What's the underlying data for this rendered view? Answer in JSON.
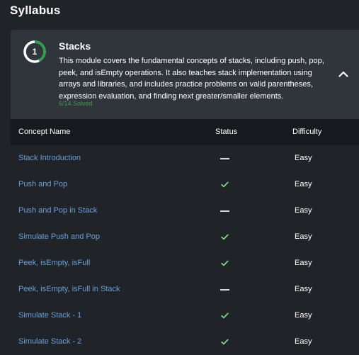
{
  "page": {
    "title": "Syllabus"
  },
  "module": {
    "number": "1",
    "progress_fraction": 0.428,
    "title": "Stacks",
    "description": "This module covers the fundamental concepts of stacks, including push, pop, peek, and isEmpty operations. It also teaches stack implementation using arrays and libraries, and includes practice problems on valid parentheses, expression evaluation, and finding next greater/smaller elements.",
    "progress_text": "6/14 Solved",
    "collapse_icon": "chevron-up-icon",
    "colors": {
      "ring_track": "#ffffff",
      "ring_fill": "#2f9e4b",
      "solved_text": "#3e9b4a",
      "link": "#6a9fd9",
      "check": "#7fd48a"
    }
  },
  "table": {
    "headers": {
      "name": "Concept Name",
      "status": "Status",
      "difficulty": "Difficulty"
    },
    "rows": [
      {
        "name": "Stack Introduction",
        "status": "unsolved",
        "difficulty": "Easy"
      },
      {
        "name": "Push and Pop",
        "status": "solved",
        "difficulty": "Easy"
      },
      {
        "name": "Push and Pop in Stack",
        "status": "unsolved",
        "difficulty": "Easy"
      },
      {
        "name": "Simulate Push and Pop",
        "status": "solved",
        "difficulty": "Easy"
      },
      {
        "name": "Peek, isEmpty, isFull",
        "status": "solved",
        "difficulty": "Easy"
      },
      {
        "name": "Peek, isEmpty, isFull in Stack",
        "status": "unsolved",
        "difficulty": "Easy"
      },
      {
        "name": "Simulate Stack - 1",
        "status": "solved",
        "difficulty": "Easy"
      },
      {
        "name": "Simulate Stack - 2",
        "status": "solved",
        "difficulty": "Easy"
      }
    ]
  }
}
